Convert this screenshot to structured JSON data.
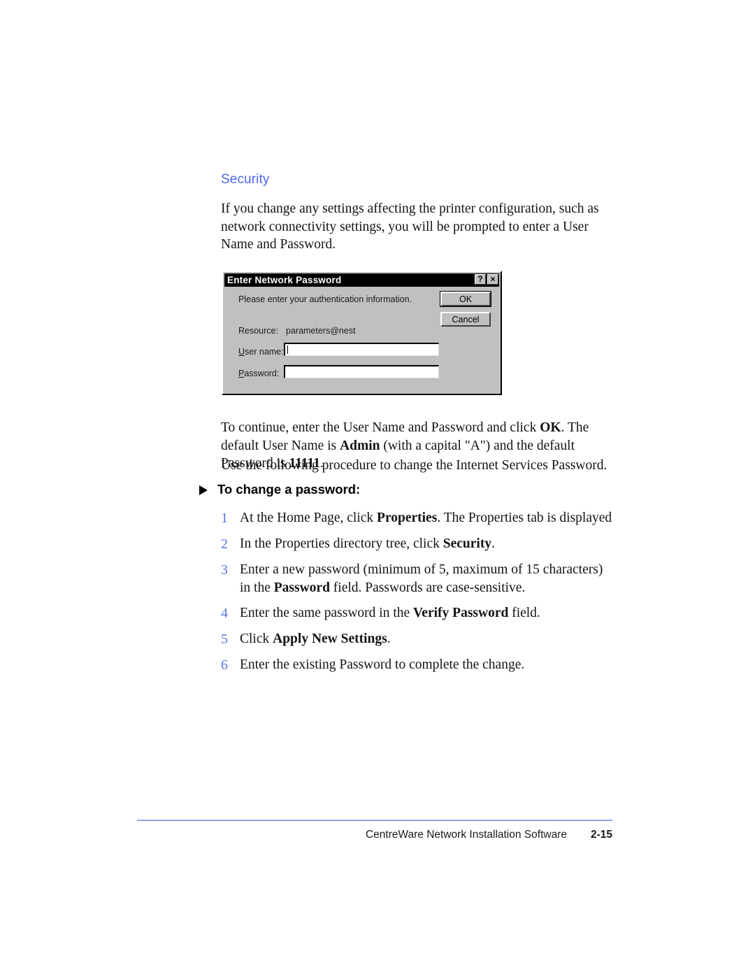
{
  "document": {
    "section_heading": "Security",
    "intro_paragraph": "If you change any settings affecting the printer configuration, such as network connectivity settings, you will be prompted to enter a User Name and Password.",
    "continue_paragraph_parts": {
      "p1": "To continue, enter the User Name and Password and click ",
      "b1": "OK",
      "p2": ". The default User Name is ",
      "b2": "Admin",
      "p3": " (with a capital \"A\") and the default Password is ",
      "b3": "11111",
      "p4": "."
    },
    "use_paragraph": "Use the following procedure to change the Internet Services Password.",
    "procedure_heading": "To change a password:",
    "steps": [
      {
        "num": "1",
        "parts": {
          "p1": "At the Home Page, click ",
          "b1": "Properties",
          "p2": ". The Properties tab is displayed"
        }
      },
      {
        "num": "2",
        "parts": {
          "p1": "In the Properties directory tree, click ",
          "b1": "Security",
          "p2": "."
        }
      },
      {
        "num": "3",
        "parts": {
          "p1": "Enter a new password (minimum of 5, maximum of 15 characters) in the ",
          "b1": "Password",
          "p2": " field. Passwords are case-sensitive."
        }
      },
      {
        "num": "4",
        "parts": {
          "p1": "Enter the same password in the ",
          "b1": "Verify Password",
          "p2": " field."
        }
      },
      {
        "num": "5",
        "parts": {
          "p1": "Click ",
          "b1": "Apply New Settings",
          "p2": "."
        }
      },
      {
        "num": "6",
        "parts": {
          "p1": "Enter the existing Password to complete the change.",
          "b1": "",
          "p2": ""
        }
      }
    ]
  },
  "dialog": {
    "title": "Enter Network Password",
    "help_button": "?",
    "close_button": "×",
    "prompt": "Please enter your authentication information.",
    "labels": {
      "resource": "Resource:",
      "username_pre": "U",
      "username_post": "ser name:",
      "password_pre": "P",
      "password_post": "assword:"
    },
    "resource_value": "parameters@nest",
    "username_value": "",
    "password_value": "",
    "buttons": {
      "ok": "OK",
      "cancel": "Cancel"
    }
  },
  "footer": {
    "title": "CentreWare Network Installation Software",
    "page_number": "2-15"
  },
  "colors": {
    "heading_blue": "#4b67e8",
    "step_number_blue": "#5577dd",
    "rule_blue": "#8fa4ee",
    "dialog_face": "#c0c0c0"
  }
}
